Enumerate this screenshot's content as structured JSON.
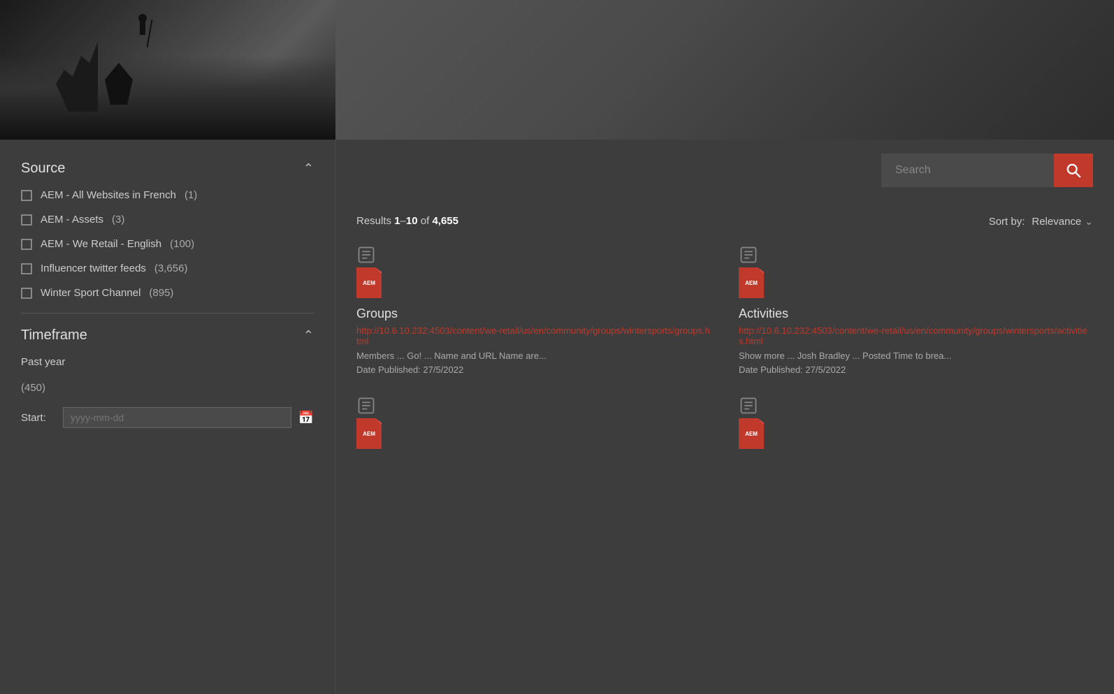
{
  "hero": {
    "alt": "Mountain hiking hero image"
  },
  "search": {
    "placeholder": "Search",
    "value": ""
  },
  "results": {
    "label": "Results",
    "range_start": "1",
    "range_end": "10",
    "separator": "of",
    "total": "4,655"
  },
  "sort": {
    "label": "Sort by:",
    "value": "Relevance"
  },
  "sidebar": {
    "source_title": "Source",
    "filters": [
      {
        "label": "AEM - All Websites in French",
        "count": "(1)"
      },
      {
        "label": "AEM - Assets",
        "count": "(3)"
      },
      {
        "label": "AEM - We Retail - English",
        "count": "(100)"
      },
      {
        "label": "Influencer twitter feeds",
        "count": "(3,656)"
      },
      {
        "label": "Winter Sport Channel",
        "count": "(895)"
      }
    ],
    "timeframe_title": "Timeframe",
    "past_year": "Past year",
    "past_year_count": "(450)",
    "date_start_label": "Start:",
    "date_start_placeholder": "yyyy-mm-dd"
  },
  "result_cards": [
    {
      "title": "Groups",
      "url": "http://10.6.10.232:4503/content/we-retail/us/en/community/groups/wintersports/groups.html",
      "snippet": "Members ... Go! ... Name and URL Name are...",
      "date": "Date Published: 27/5/2022",
      "doc_label": "AEM"
    },
    {
      "title": "Activities",
      "url": "http://10.6.10.232:4503/content/we-retail/us/en/community/groups/wintersports/activities.html",
      "snippet": "Show more ... Josh Bradley ... Posted Time to brea...",
      "date": "Date Published: 27/5/2022",
      "doc_label": "AEM"
    },
    {
      "title": "",
      "url": "",
      "snippet": "",
      "date": "",
      "doc_label": "AEM"
    },
    {
      "title": "",
      "url": "",
      "snippet": "",
      "date": "",
      "doc_label": "AEM"
    }
  ]
}
